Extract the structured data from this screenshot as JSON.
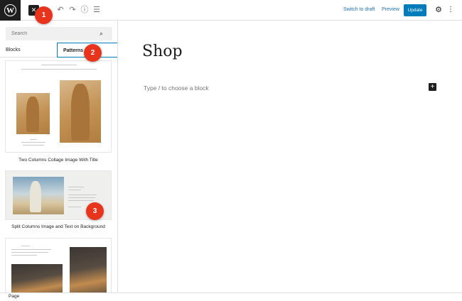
{
  "topbar": {
    "close_icon": "close-icon",
    "undo_icon": "undo-icon",
    "redo_icon": "redo-icon",
    "info_icon": "info-icon",
    "list_view_icon": "list-view-icon",
    "switch_to_draft": "Switch to draft",
    "preview": "Preview",
    "update": "Update",
    "settings_icon": "gear-icon",
    "options_icon": "kebab-menu-icon"
  },
  "sidebar": {
    "search_placeholder": "Search",
    "tabs": [
      {
        "label": "Blocks"
      },
      {
        "label": "Patterns"
      }
    ],
    "patterns": [
      {
        "label": "Two Columns Collage Image With Title"
      },
      {
        "label": "Split Columns Image and Text on Background"
      },
      {
        "label": ""
      }
    ]
  },
  "canvas": {
    "title": "Shop",
    "placeholder": "Type / to choose a block"
  },
  "badges": [
    "1",
    "2",
    "3"
  ],
  "footer": {
    "breadcrumb": "Page"
  },
  "colors": {
    "accent": "#007cba",
    "badge": "#e8331d",
    "dark": "#1e1e1e"
  }
}
